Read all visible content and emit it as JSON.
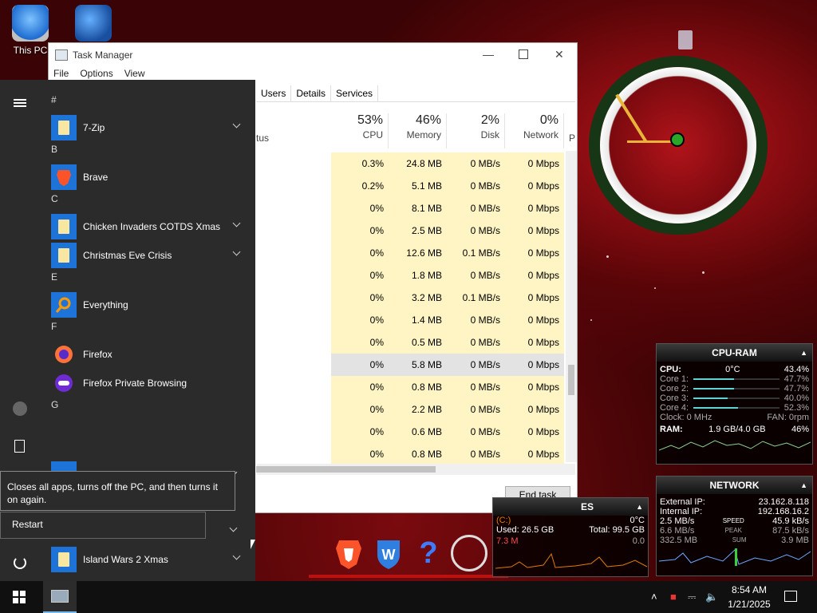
{
  "desktop": {
    "icons": [
      {
        "label": "This PC"
      }
    ]
  },
  "task_manager": {
    "title": "Task Manager",
    "menu": [
      "File",
      "Options",
      "View"
    ],
    "tabs": [
      "Users",
      "Details",
      "Services"
    ],
    "status_col": "tus",
    "columns": [
      {
        "pct": "53%",
        "label": "CPU"
      },
      {
        "pct": "46%",
        "label": "Memory"
      },
      {
        "pct": "2%",
        "label": "Disk"
      },
      {
        "pct": "0%",
        "label": "Network"
      }
    ],
    "extra_col": "P",
    "rows": [
      {
        "cpu": "0.3%",
        "mem": "24.8 MB",
        "disk": "0 MB/s",
        "net": "0 Mbps"
      },
      {
        "cpu": "0.2%",
        "mem": "5.1 MB",
        "disk": "0 MB/s",
        "net": "0 Mbps"
      },
      {
        "cpu": "0%",
        "mem": "8.1 MB",
        "disk": "0 MB/s",
        "net": "0 Mbps"
      },
      {
        "cpu": "0%",
        "mem": "2.5 MB",
        "disk": "0 MB/s",
        "net": "0 Mbps"
      },
      {
        "cpu": "0%",
        "mem": "12.6 MB",
        "disk": "0.1 MB/s",
        "net": "0 Mbps"
      },
      {
        "cpu": "0%",
        "mem": "1.8 MB",
        "disk": "0 MB/s",
        "net": "0 Mbps"
      },
      {
        "cpu": "0%",
        "mem": "3.2 MB",
        "disk": "0.1 MB/s",
        "net": "0 Mbps"
      },
      {
        "cpu": "0%",
        "mem": "1.4 MB",
        "disk": "0 MB/s",
        "net": "0 Mbps"
      },
      {
        "cpu": "0%",
        "mem": "0.5 MB",
        "disk": "0 MB/s",
        "net": "0 Mbps"
      },
      {
        "cpu": "0%",
        "mem": "5.8 MB",
        "disk": "0 MB/s",
        "net": "0 Mbps"
      },
      {
        "cpu": "0%",
        "mem": "0.8 MB",
        "disk": "0 MB/s",
        "net": "0 Mbps"
      },
      {
        "cpu": "0%",
        "mem": "2.2 MB",
        "disk": "0 MB/s",
        "net": "0 Mbps"
      },
      {
        "cpu": "0%",
        "mem": "0.6 MB",
        "disk": "0 MB/s",
        "net": "0 Mbps"
      },
      {
        "cpu": "0%",
        "mem": "0.8 MB",
        "disk": "0 MB/s",
        "net": "0 Mbps"
      }
    ],
    "end_task": "End task"
  },
  "start_menu": {
    "groups": [
      {
        "letter": "#",
        "apps": [
          {
            "name": "7-Zip",
            "icon": "folder-icon",
            "expand": true
          }
        ]
      },
      {
        "letter": "B",
        "apps": [
          {
            "name": "Brave",
            "icon": "brave-icon",
            "expand": false
          }
        ]
      },
      {
        "letter": "C",
        "apps": [
          {
            "name": "Chicken Invaders COTDS Xmas",
            "icon": "folder-icon",
            "expand": true
          },
          {
            "name": "Christmas Eve Crisis",
            "icon": "folder-icon",
            "expand": true
          }
        ]
      },
      {
        "letter": "E",
        "apps": [
          {
            "name": "Everything",
            "icon": "search-icon",
            "expand": false
          }
        ]
      },
      {
        "letter": "F",
        "apps": [
          {
            "name": "Firefox",
            "icon": "firefox-icon",
            "expand": false
          },
          {
            "name": "Firefox Private Browsing",
            "icon": "private-browsing-icon",
            "expand": false
          }
        ]
      },
      {
        "letter": "G",
        "apps": []
      }
    ],
    "last_app": "Island Wars 2 Xmas",
    "tooltip": "Closes all apps, turns off the PC, and then turns it on again.",
    "restart": "Restart"
  },
  "disk_gadget": {
    "title_fragment": "ES",
    "temp_label": "(C:)",
    "temp": "0°C",
    "used": "Used: 26.5 GB",
    "total": "Total: 99.5 GB",
    "read": "7.3 M",
    "write": "0.0"
  },
  "cpu_ram_gadget": {
    "title": "CPU-RAM",
    "cpu_label": "CPU:",
    "cpu_temp": "0°C",
    "cpu_pct": "43.4%",
    "cores": [
      {
        "label": "Core 1:",
        "pct": "47.7%",
        "level": 0.477
      },
      {
        "label": "Core 2:",
        "pct": "47.7%",
        "level": 0.477
      },
      {
        "label": "Core 3:",
        "pct": "40.0%",
        "level": 0.4
      },
      {
        "label": "Core 4:",
        "pct": "52.3%",
        "level": 0.523
      }
    ],
    "clock": "Clock: 0 MHz",
    "fan": "FAN: 0rpm",
    "ram_label": "RAM:",
    "ram_value": "1.9 GB/4.0 GB",
    "ram_pct": "46%"
  },
  "network_gadget": {
    "title": "NETWORK",
    "external_label": "External IP:",
    "external_ip": "23.162.8.118",
    "internal_label": "Internal IP:",
    "internal_ip": "192.168.16.2",
    "speed_down": "2.5 MB/s",
    "speed_label": "SPEED",
    "speed_up": "45.9 kB/s",
    "peak_down": "6.6 MB/s",
    "peak_label": "PEAK",
    "peak_up": "87.5 kB/s",
    "sum_down": "332.5 MB",
    "sum_label": "SUM",
    "sum_up": "3.9 MB"
  },
  "taskbar": {
    "time": "8:54 AM",
    "date": "1/21/2025"
  },
  "colors": {
    "start_bg": "#2b2b2b",
    "highlight": "#fff4c4",
    "accent": "#76b9ed"
  }
}
